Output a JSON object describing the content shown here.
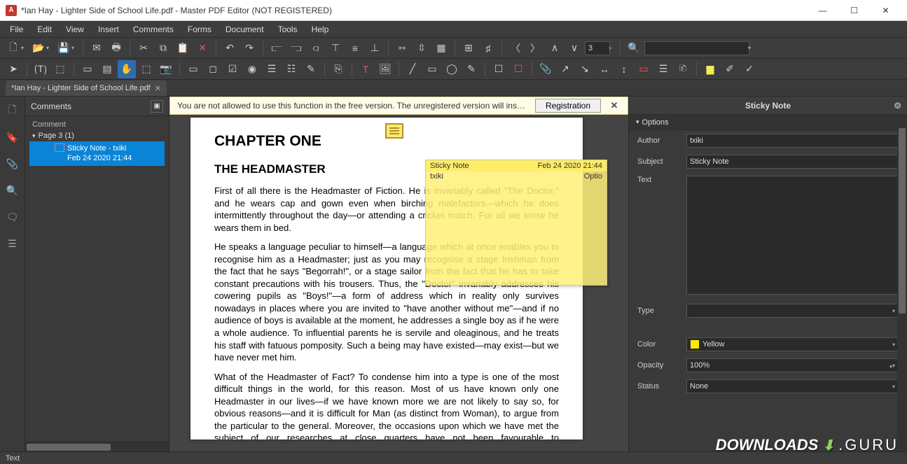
{
  "window": {
    "title": "*Ian Hay - Lighter Side of School Life.pdf - Master PDF Editor (NOT REGISTERED)"
  },
  "menu": [
    "File",
    "Edit",
    "View",
    "Insert",
    "Comments",
    "Forms",
    "Document",
    "Tools",
    "Help"
  ],
  "page_number": "3",
  "tab": {
    "label": "*Ian Hay - Lighter Side of School Life.pdf"
  },
  "comments_panel": {
    "title": "Comments",
    "column": "Comment",
    "page_label": "Page 3 (1)",
    "note_line1": "Sticky Note - txiki",
    "note_line2": "Feb 24 2020 21:44"
  },
  "notice": {
    "text": "You are not allowed to use this function in the free version.   The unregistered version will insert a wa",
    "button": "Registration"
  },
  "document": {
    "chapter": "CHAPTER ONE",
    "section": "THE HEADMASTER",
    "p1": "First of all there is the Headmaster of Fiction. He is invariably called \"The Doctor,\" and he wears cap and gown even when birching malefactors—which he does intermittently throughout the day—or attending a cricket match. For all we know he wears them in bed.",
    "p2": "He speaks a language peculiar to himself—a language which at once enables you to recognise him as a Headmaster; just as you may recognise a stage Irishman from the fact that he says \"Begorrah!\", or a stage sailor from the fact that he has to take constant precautions with his trousers. Thus, the \"Doctor\" invariably addresses his cowering pupils as \"Boys!\"—a form of address which in reality only survives nowadays in places where you are invited to \"have another without me\"—and if no audience of boys is available at the moment, he addresses a single boy as if he were a whole audience. To influential parents he is servile and oleaginous, and he treats his staff with fatuous pomposity. Such a being may have existed—may exist—but we have never met him.",
    "p3": "What of the Headmaster of Fact? To condense him into a type is one of the most difficult things in the world, for this reason. Most of us have known only one Headmaster in our lives—if we have known more we are not likely to say so, for obvious reasons—and it is difficult for Man (as distinct from Woman), to argue from the particular to the general. Moreover, the occasions upon which we have met the subject of our researches at close quarters have not been favourable to dispassionate character-study. It is difficult to form"
  },
  "sticky_popup": {
    "title": "Sticky Note",
    "date": "Feb 24 2020 21:44",
    "author": "txiki",
    "options": "Optio"
  },
  "inspector": {
    "title": "Sticky Note",
    "options_section": "Options",
    "author_label": "Author",
    "author_value": "txiki",
    "subject_label": "Subject",
    "subject_value": "Sticky Note",
    "text_label": "Text",
    "text_value": "",
    "type_label": "Type",
    "type_value": "",
    "color_label": "Color",
    "color_value": "Yellow",
    "opacity_label": "Opacity",
    "opacity_value": "100%",
    "status_label": "Status",
    "status_value": "None"
  },
  "statusbar": {
    "mode": "Text"
  },
  "watermark": {
    "brand1": "DOWNLOADS",
    "brand2": ".GURU"
  }
}
